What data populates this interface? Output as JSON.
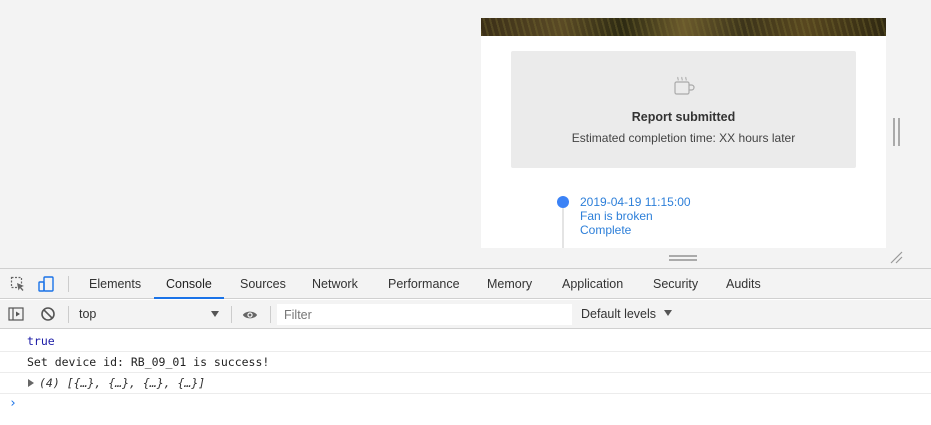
{
  "viewport": {
    "report_card": {
      "icon": "coffee-cup-icon",
      "title": "Report submitted",
      "subtitle": "Estimated completion time: XX hours later"
    },
    "timeline": {
      "datetime": "2019-04-19 11:15:00",
      "issue": "Fan is broken",
      "status": "Complete",
      "accent_color": "#3b82f6"
    }
  },
  "devtools": {
    "tabs": [
      {
        "label": "Elements"
      },
      {
        "label": "Console",
        "active": true
      },
      {
        "label": "Sources"
      },
      {
        "label": "Network"
      },
      {
        "label": "Performance"
      },
      {
        "label": "Memory"
      },
      {
        "label": "Application"
      },
      {
        "label": "Security"
      },
      {
        "label": "Audits"
      }
    ],
    "toolbar": {
      "context": "top",
      "filter_placeholder": "Filter",
      "levels": "Default levels"
    },
    "console": {
      "lines": [
        {
          "type": "boolean",
          "text": "true"
        },
        {
          "type": "log",
          "text": "Set device id: RB_09_01 is success!"
        },
        {
          "type": "object",
          "text": "(4) [{…}, {…}, {…}, {…}]"
        }
      ],
      "prompt": "›"
    },
    "accent_color": "#1a73e8"
  }
}
